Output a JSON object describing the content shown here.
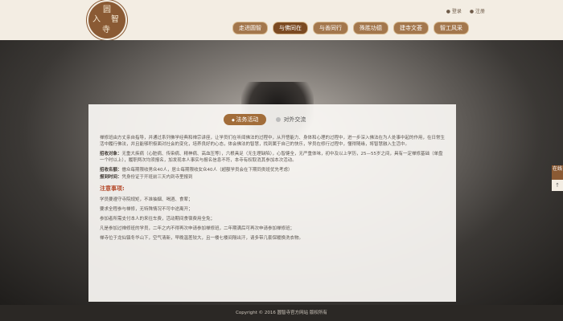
{
  "logo": {
    "chars": [
      "圆",
      "智",
      "寺",
      "入"
    ]
  },
  "top_links": {
    "login": "登录",
    "register": "注册"
  },
  "nav": [
    {
      "label": "走进圆智",
      "active": false
    },
    {
      "label": "与佛同在",
      "active": true
    },
    {
      "label": "与善同行",
      "active": false
    },
    {
      "label": "殊胜功德",
      "active": false
    },
    {
      "label": "建寺文荟",
      "active": false
    },
    {
      "label": "智工风采",
      "active": false
    }
  ],
  "tabs": {
    "active": "法务活动",
    "other": "对外交流"
  },
  "content": {
    "intro": "禅修班由方丈亲自指导，并通过系列佛学经典和禅宗讲座，让学员们在听闻佛法的过程中，从开悟能力、身体和心理的过程中，进一步深入佛法在为人处事中起的作用，在日常生活中履行佛法，并且能够积极面对社会的变化，培养良好的心态，体会佛法的智慧，找到属于自己的快乐，学员在修行过程中，懂得随缘，将智慧融入生活中。",
    "target_label": "招收对象：",
    "target_text": "无重大疾病（心脏病、传染病、精神病、高血压等），六根具足（无生理缺陷），心智健全，无严重体味，初中及以上学历，25—55岁之间，具有一定禅修基础（单盘一个时以上），履职两次均须报名，加发现本人事实与报名信息不符，本寺有权取消其参加本次活动。",
    "quota_label": "招收名额：",
    "quota_text": "僧众每期限收男众40人，居士每期限收女众40人（超额学员会在下期同类班优先考虑）",
    "time_label": "报到时间：",
    "time_text": "凭身份证于开班前三天内到寺里报到",
    "notice_title": "注意事项:",
    "notes": [
      "学员要遵守寺院规矩，不准抽烟、喝酒、食荤；",
      "要求全程参与禅修，无特殊情况不可中途离开；",
      "参加者所需支付本人的来往车费，活动期间食宿费用全免；",
      "凡是参加过禅修班的学员，二年之内不得再次申请参加禅修班，二年期满后可再次申请参加禅修班；",
      "禅寺位于龙仙镇冬华山下，空气清新，早晚温差较大，且一楼七楼间隔出汗，请多带几套保暖换洗衣物。"
    ]
  },
  "footer": "Copyright © 2016 圆智寺官方网站 版权所有",
  "side": {
    "button": "在线",
    "up_icon": "↑"
  }
}
